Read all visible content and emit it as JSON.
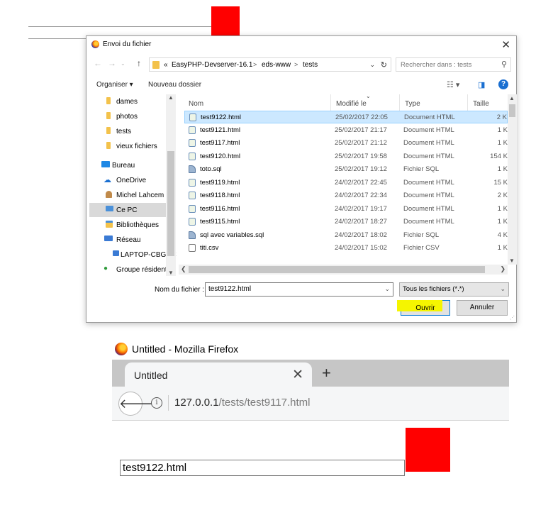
{
  "colors": {
    "red_box": "#ff0000",
    "selection": "#cce8ff",
    "highlight": "#f5f500",
    "accent": "#0078d7"
  },
  "dialog": {
    "title": "Envoi du fichier",
    "close_icon": "close-icon",
    "address": {
      "chevrons": "«",
      "crumbs": [
        "EasyPHP-Devserver-16.1",
        "eds-www",
        "tests"
      ],
      "separator": ">"
    },
    "search_placeholder": "Rechercher dans : tests",
    "toolbar": {
      "organize": "Organiser ▾",
      "new_folder": "Nouveau dossier",
      "help": "?"
    },
    "nav": [
      {
        "label": "dames",
        "icon": "folder-icon"
      },
      {
        "label": "photos",
        "icon": "folder-icon"
      },
      {
        "label": "tests",
        "icon": "folder-icon"
      },
      {
        "label": "vieux fichiers",
        "icon": "folder-icon"
      },
      {
        "label": "Bureau",
        "icon": "desktop-icon"
      },
      {
        "label": "OneDrive",
        "icon": "cloud-icon"
      },
      {
        "label": "Michel Lahcem",
        "icon": "user-icon"
      },
      {
        "label": "Ce PC",
        "icon": "pc-icon",
        "selected": true
      },
      {
        "label": "Bibliothèques",
        "icon": "library-icon"
      },
      {
        "label": "Réseau",
        "icon": "network-icon"
      },
      {
        "label": "LAPTOP-CBGUC",
        "icon": "computer-icon"
      },
      {
        "label": "Groupe résidenti",
        "icon": "homegroup-icon"
      }
    ],
    "columns": {
      "name": "Nom",
      "modified": "Modifié le",
      "type": "Type",
      "size": "Taille"
    },
    "files": [
      {
        "name": "test9122.html",
        "modified": "25/02/2017 22:05",
        "type": "Document HTML",
        "size": "2 K",
        "icon": "html",
        "selected": true
      },
      {
        "name": "test9121.html",
        "modified": "25/02/2017 21:17",
        "type": "Document HTML",
        "size": "1 K",
        "icon": "html"
      },
      {
        "name": "test9117.html",
        "modified": "25/02/2017 21:12",
        "type": "Document HTML",
        "size": "1 K",
        "icon": "html"
      },
      {
        "name": "test9120.html",
        "modified": "25/02/2017 19:58",
        "type": "Document HTML",
        "size": "154 K",
        "icon": "html"
      },
      {
        "name": "toto.sql",
        "modified": "25/02/2017 19:12",
        "type": "Fichier SQL",
        "size": "1 K",
        "icon": "sql"
      },
      {
        "name": "test9119.html",
        "modified": "24/02/2017 22:45",
        "type": "Document HTML",
        "size": "15 K",
        "icon": "html"
      },
      {
        "name": "test9118.html",
        "modified": "24/02/2017 22:34",
        "type": "Document HTML",
        "size": "2 K",
        "icon": "html"
      },
      {
        "name": "test9116.html",
        "modified": "24/02/2017 19:17",
        "type": "Document HTML",
        "size": "1 K",
        "icon": "html"
      },
      {
        "name": "test9115.html",
        "modified": "24/02/2017 18:27",
        "type": "Document HTML",
        "size": "1 K",
        "icon": "html"
      },
      {
        "name": "sql avec variables.sql",
        "modified": "24/02/2017 18:02",
        "type": "Fichier SQL",
        "size": "4 K",
        "icon": "sql"
      },
      {
        "name": "titi.csv",
        "modified": "24/02/2017 15:02",
        "type": "Fichier CSV",
        "size": "1 K",
        "icon": "csv"
      }
    ],
    "filename_label": "Nom du fichier :",
    "filename_value": "test9122.html",
    "filter": "Tous les fichiers (*.*)",
    "open_button": "Ouvrir",
    "cancel_button": "Annuler"
  },
  "firefox": {
    "window_title": "Untitled - Mozilla Firefox",
    "tab_title": "Untitled",
    "tab_close": "✕",
    "new_tab": "+",
    "url_host": "127.0.0.1",
    "url_path": "/tests/test9117.html",
    "info_glyph": "i",
    "back_glyph": "🡐"
  },
  "page": {
    "file_input_value": "test9122.html"
  }
}
